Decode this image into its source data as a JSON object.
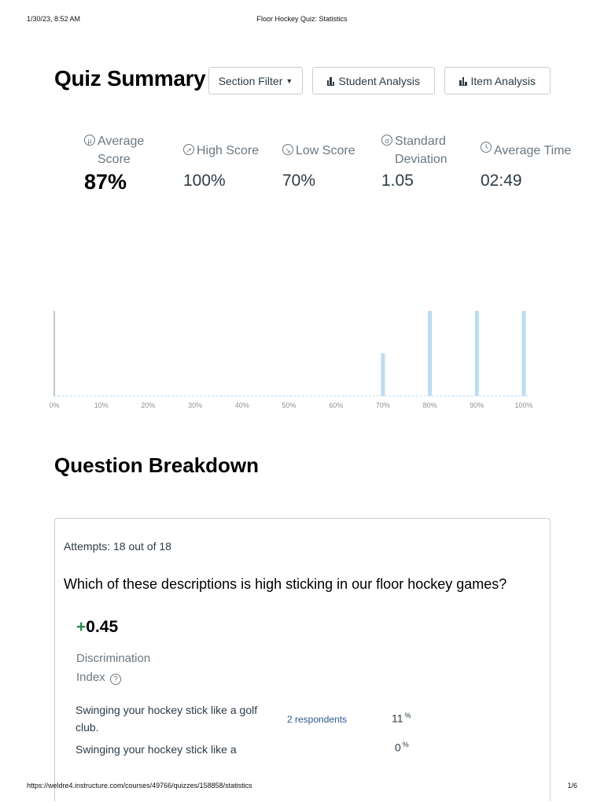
{
  "print_header": {
    "datetime": "1/30/23, 8:52 AM",
    "page_title": "Floor Hockey Quiz: Statistics"
  },
  "summary": {
    "title": "Quiz Summary",
    "section_filter_label": "Section Filter",
    "student_analysis_label": "Student Analysis",
    "item_analysis_label": "Item Analysis"
  },
  "stats": [
    {
      "icon": "mu-icon",
      "glyph": "μ",
      "label": "Average Score",
      "value": "87%"
    },
    {
      "icon": "arrow-up-right-icon",
      "glyph": "↗",
      "label": "High Score",
      "value": "100%"
    },
    {
      "icon": "arrow-down-right-icon",
      "glyph": "↘",
      "label": "Low Score",
      "value": "70%"
    },
    {
      "icon": "sigma-icon",
      "glyph": "σ",
      "label": "Standard Deviation",
      "value": "1.05"
    },
    {
      "icon": "clock-icon",
      "glyph": "",
      "label": "Average Time",
      "value": "02:49"
    }
  ],
  "chart_data": {
    "type": "bar",
    "categories": [
      "0%",
      "10%",
      "20%",
      "30%",
      "40%",
      "50%",
      "60%",
      "70%",
      "80%",
      "90%",
      "100%"
    ],
    "values": [
      0,
      0,
      0,
      0,
      0,
      0,
      0,
      2,
      4,
      4,
      4
    ],
    "title": "",
    "xlabel": "",
    "ylabel": "",
    "ylim": [
      0,
      4
    ],
    "grid": false,
    "bar_color": "#bddcf0"
  },
  "breakdown": {
    "title": "Question Breakdown",
    "attempts": "Attempts: 18 out of 18",
    "question": "Which of these descriptions is high sticking in our floor hockey games?",
    "discrimination_sign": "+",
    "discrimination_value": "0.45",
    "discrimination_label_1": "Discrimination",
    "discrimination_label_2": "Index",
    "help_glyph": "?",
    "answers": [
      {
        "text": "Swinging your hockey stick like a golf club.",
        "respondents": "2 respondents",
        "percent": "11",
        "percent_sign": "%"
      },
      {
        "text": "Swinging your hockey stick like a",
        "respondents": "",
        "percent": "0",
        "percent_sign": "%"
      }
    ]
  },
  "print_footer": {
    "url": "https://weldre4.instructure.com/courses/49766/quizzes/158858/statistics",
    "page": "1/6"
  },
  "colors": {
    "accent_green": "#2a8b4a",
    "link_blue": "#2b5a8a",
    "bar_blue": "#bddcf0"
  }
}
